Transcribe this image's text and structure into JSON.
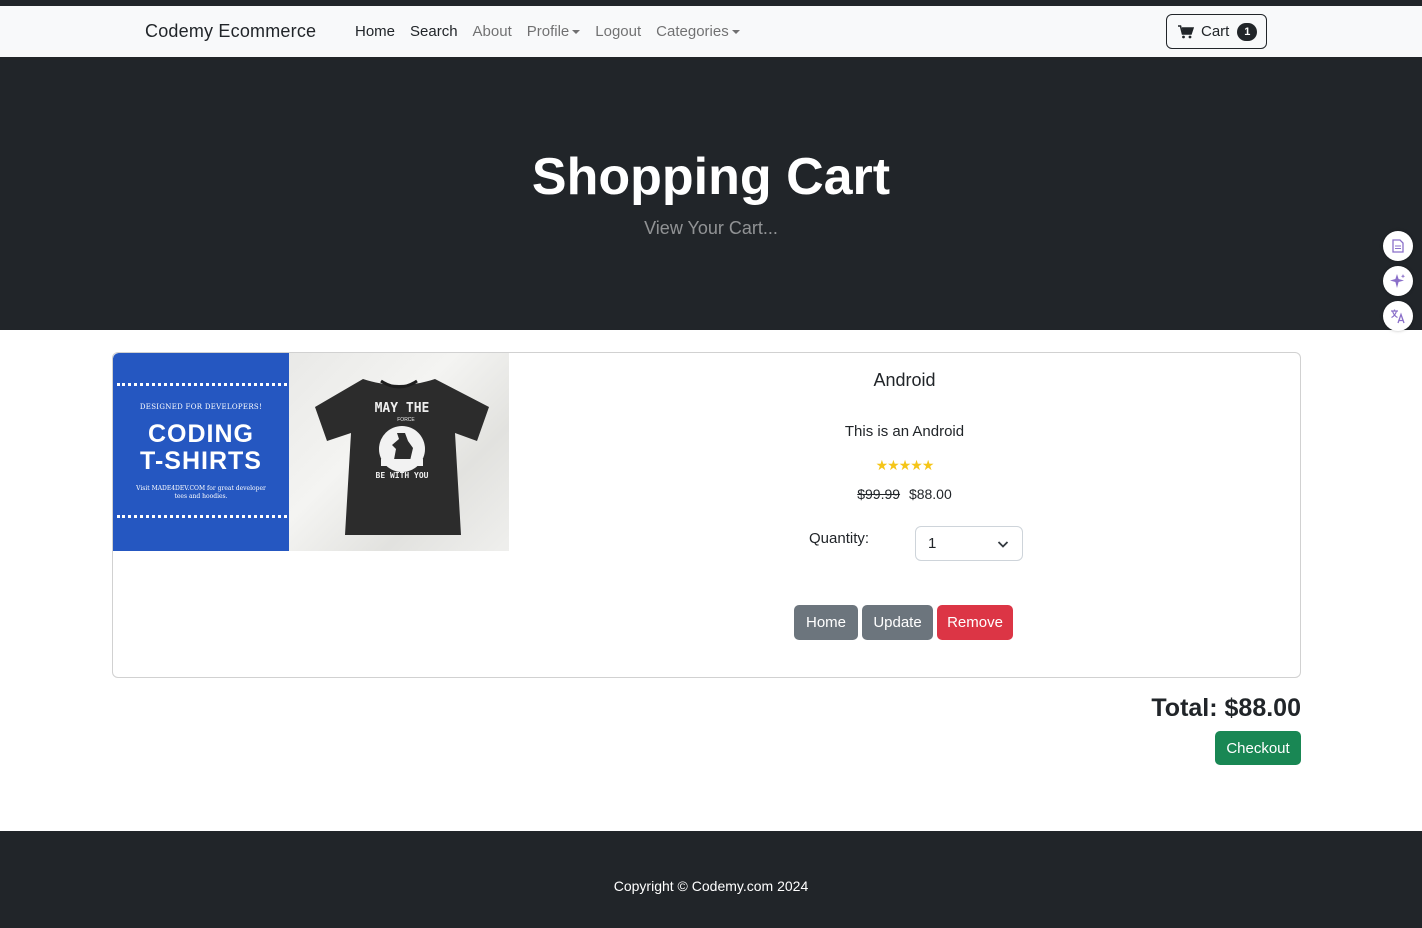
{
  "navbar": {
    "brand": "Codemy Ecommerce",
    "links": [
      {
        "label": "Home"
      },
      {
        "label": "Search"
      },
      {
        "label": "About"
      },
      {
        "label": "Profile"
      },
      {
        "label": "Logout"
      },
      {
        "label": "Categories"
      }
    ],
    "cart": {
      "label": "Cart",
      "count": "1",
      "icon": "cart-icon"
    }
  },
  "hero": {
    "title": "Shopping Cart",
    "subtitle": "View Your Cart..."
  },
  "side_tools": [
    {
      "icon": "document-icon"
    },
    {
      "icon": "sparkle-icon"
    },
    {
      "icon": "translate-icon"
    }
  ],
  "product": {
    "image": {
      "banner_tag": "DESIGNED FOR DEVELOPERS!",
      "banner_line1": "CODING",
      "banner_line2": "T-SHIRTS",
      "banner_visit": "Visit MADE4DEV.COM for great developer tees and hoodies.",
      "shirt_top": "MAY THE",
      "shirt_force": "FORCE",
      "shirt_bottom": "BE WITH YOU"
    },
    "name": "Android",
    "description": "This is an Android",
    "rating": 5,
    "stars": "★★★★★",
    "old_price": "$99.99",
    "price": "$88.00",
    "quantity_label": "Quantity:",
    "quantity_value": "1",
    "buttons": {
      "home": "Home",
      "update": "Update",
      "remove": "Remove"
    }
  },
  "summary": {
    "total": "Total: $88.00",
    "checkout": "Checkout"
  },
  "footer": {
    "copyright": "Copyright © Codemy.com 2024"
  },
  "colors": {
    "dark": "#212529",
    "secondary": "#6c757d",
    "danger": "#dc3545",
    "success": "#198754",
    "star": "#f5c518",
    "banner_blue": "#2557c1"
  }
}
